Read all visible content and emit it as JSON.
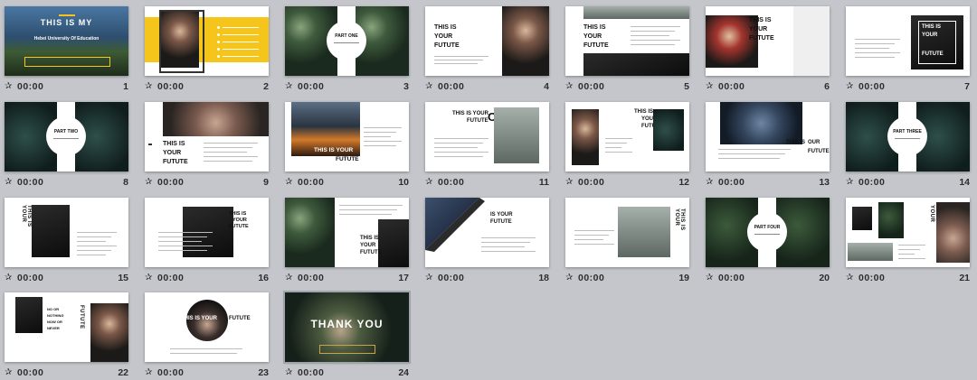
{
  "slide_sorter": {
    "time_label": "00:00",
    "star_glyph": "✰",
    "slides": [
      {
        "number": "1",
        "text": {
          "title": "THIS IS MY",
          "subtitle": "Hebei University Of Education"
        }
      },
      {
        "number": "2",
        "text": {}
      },
      {
        "number": "3",
        "text": {
          "part": "PART ONE"
        }
      },
      {
        "number": "4",
        "text": {
          "l1": "THIS IS",
          "l2": "YOUR",
          "l3": "FUTUTE"
        }
      },
      {
        "number": "5",
        "text": {
          "l1": "THIS IS",
          "l2": "YOUR",
          "l3": "FUTUTE"
        }
      },
      {
        "number": "6",
        "text": {
          "l1": "THIS IS",
          "l2": "YOUR",
          "l3": "FUTUTE"
        }
      },
      {
        "number": "7",
        "text": {
          "l1": "THIS IS",
          "l2": "YOUR",
          "l3": "FUTUTE"
        }
      },
      {
        "number": "8",
        "text": {
          "part": "PART TWO"
        }
      },
      {
        "number": "9",
        "text": {
          "l1": "THIS IS",
          "l2": "YOUR",
          "l3": "FUTUTE"
        }
      },
      {
        "number": "10",
        "text": {
          "l1": "THIS IS YOUR",
          "l2": "FUTUTE"
        }
      },
      {
        "number": "11",
        "text": {
          "l1": "THIS IS YOUR",
          "l2": "FUTUTE",
          "big": "OR"
        }
      },
      {
        "number": "12",
        "text": {
          "l1": "THIS IS",
          "l2": "YOUR",
          "l3": "FUTUTE"
        }
      },
      {
        "number": "13",
        "text": {
          "l1": "THIS IS",
          "l2": "OUR",
          "l3": "FUTUTE"
        }
      },
      {
        "number": "14",
        "text": {
          "part": "PART THREE"
        }
      },
      {
        "number": "15",
        "text": {
          "vertical": "THIS IS YOUR"
        }
      },
      {
        "number": "16",
        "text": {
          "l1": "THIS IS",
          "l2": "YOUR",
          "l3": "FUTUTE"
        }
      },
      {
        "number": "17",
        "text": {
          "l1": "THIS IS",
          "l2": "YOUR",
          "l3": "FUTUTE"
        }
      },
      {
        "number": "18",
        "text": {
          "l1": "IS YOUR",
          "l2": "FUTUTE"
        }
      },
      {
        "number": "19",
        "text": {
          "vertical": "THIS IS YOUR"
        }
      },
      {
        "number": "20",
        "text": {
          "part": "PART FOUR"
        }
      },
      {
        "number": "21",
        "text": {
          "vertical": "THIS IS YOUR"
        }
      },
      {
        "number": "22",
        "text": {
          "vertical": "FUTUTE",
          "side1": "NO OR",
          "side2": "NOTHING",
          "side3": "NOW OR",
          "side4": "NEVER"
        }
      },
      {
        "number": "23",
        "text": {
          "l1": "THIS IS YOUR",
          "l2": "FUTUTE"
        }
      },
      {
        "number": "24",
        "text": {
          "title": "THANK YOU"
        }
      }
    ]
  }
}
